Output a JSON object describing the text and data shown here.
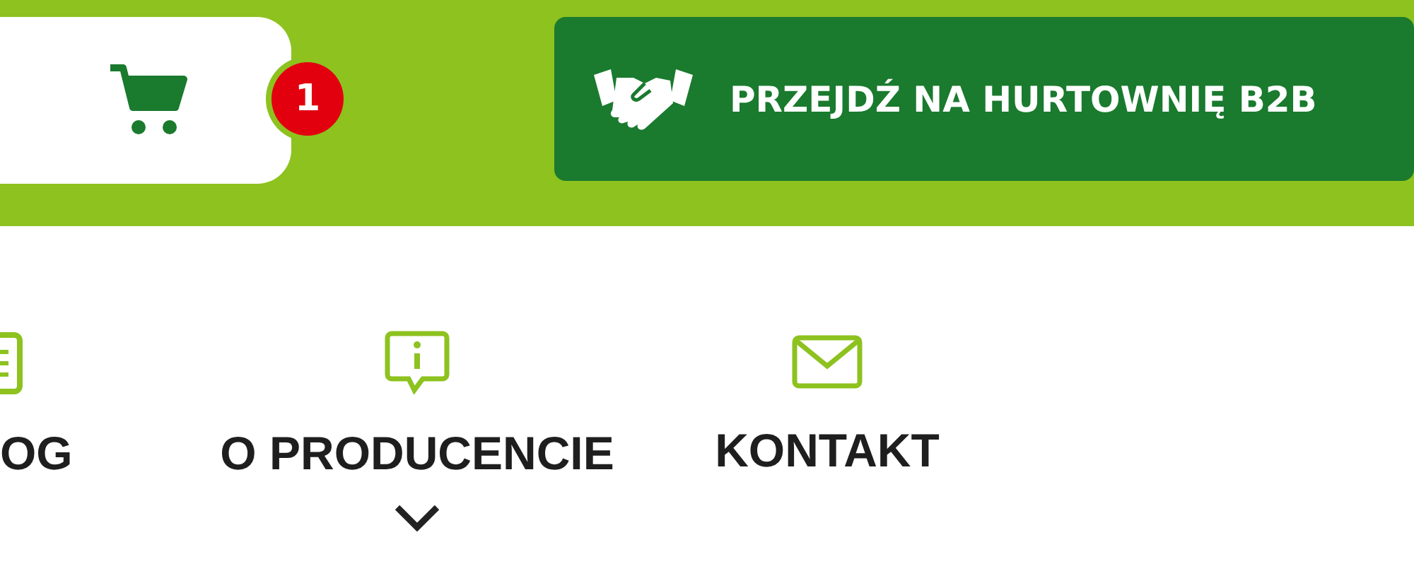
{
  "header": {
    "cart": {
      "badge": "1"
    },
    "b2b_button": {
      "label": "PRZEJDŹ NA HURTOWNIĘ B2B"
    }
  },
  "nav": [
    {
      "kind": "document",
      "label": "OG",
      "has_submenu": false
    },
    {
      "kind": "info",
      "label": "O PRODUCENCIE",
      "has_submenu": true
    },
    {
      "kind": "mail",
      "label": "KONTAKT",
      "has_submenu": false
    }
  ]
}
